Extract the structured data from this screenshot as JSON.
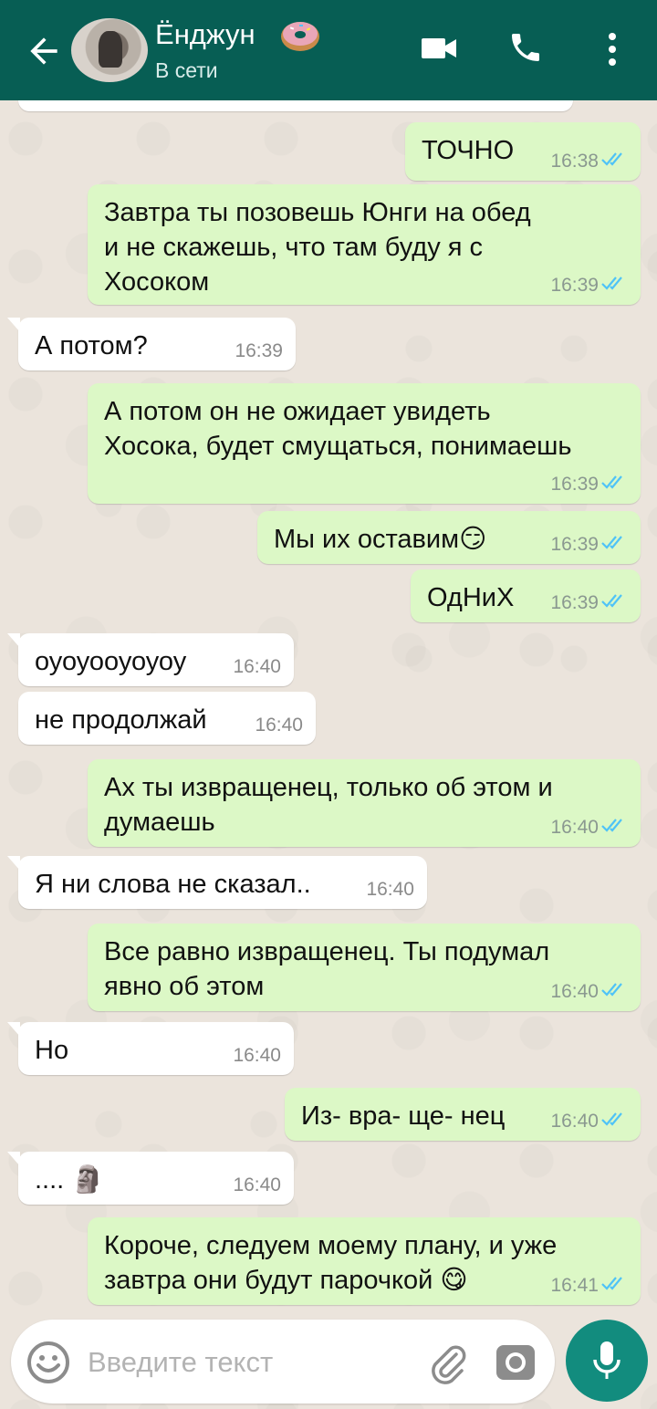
{
  "header": {
    "contact_name": "Ёнджун",
    "status": "В сети",
    "bg_color": "#075e54"
  },
  "messages": [
    {
      "dir": "out",
      "text": "ТОЧНО",
      "time": "16:38"
    },
    {
      "dir": "out",
      "text": "Завтра ты позовешь Юнги на обед\nи не скажешь, что там буду я с\nХосоком",
      "time": "16:39"
    },
    {
      "dir": "in",
      "text": "А потом?",
      "time": "16:39"
    },
    {
      "dir": "out",
      "text": "А потом он не ожидает увидеть\nХосока, будет смущаться, понимаешь",
      "time": "16:39"
    },
    {
      "dir": "out",
      "text": "Мы их оставим😏",
      "time": "16:39"
    },
    {
      "dir": "out",
      "text": "ОдНиХ",
      "time": "16:39"
    },
    {
      "dir": "in",
      "text": "оуоуооуоуоу",
      "time": "16:40"
    },
    {
      "dir": "in",
      "text": "не продолжай",
      "time": "16:40"
    },
    {
      "dir": "out",
      "text": "Ах ты извращенец, только об этом и\nдумаешь",
      "time": "16:40"
    },
    {
      "dir": "in",
      "text": "Я ни слова не сказал..",
      "time": "16:40"
    },
    {
      "dir": "out",
      "text": "Все равно извращенец. Ты подумал\nявно об этом",
      "time": "16:40"
    },
    {
      "dir": "in",
      "text": "Но",
      "time": "16:40"
    },
    {
      "dir": "out",
      "text": "Из- вра- ще- нец",
      "time": "16:40"
    },
    {
      "dir": "in",
      "text": ".... 🗿",
      "time": "16:40"
    },
    {
      "dir": "out",
      "text": "Короче, следуем моему плану, и уже\nзавтра они будут парочкой 😋",
      "time": "16:41"
    }
  ],
  "composer": {
    "placeholder": "Введите текст"
  },
  "icons": {
    "back": "back-arrow-icon",
    "video": "video-call-icon",
    "call": "phone-icon",
    "menu": "more-vert-icon",
    "emoji": "emoji-icon",
    "attach": "paperclip-icon",
    "camera": "camera-icon",
    "mic": "mic-icon"
  },
  "colors": {
    "outgoing_bubble": "#dcf8c6",
    "incoming_bubble": "#ffffff",
    "read_tick": "#4fc3f7",
    "mic_button": "#128c7e"
  }
}
